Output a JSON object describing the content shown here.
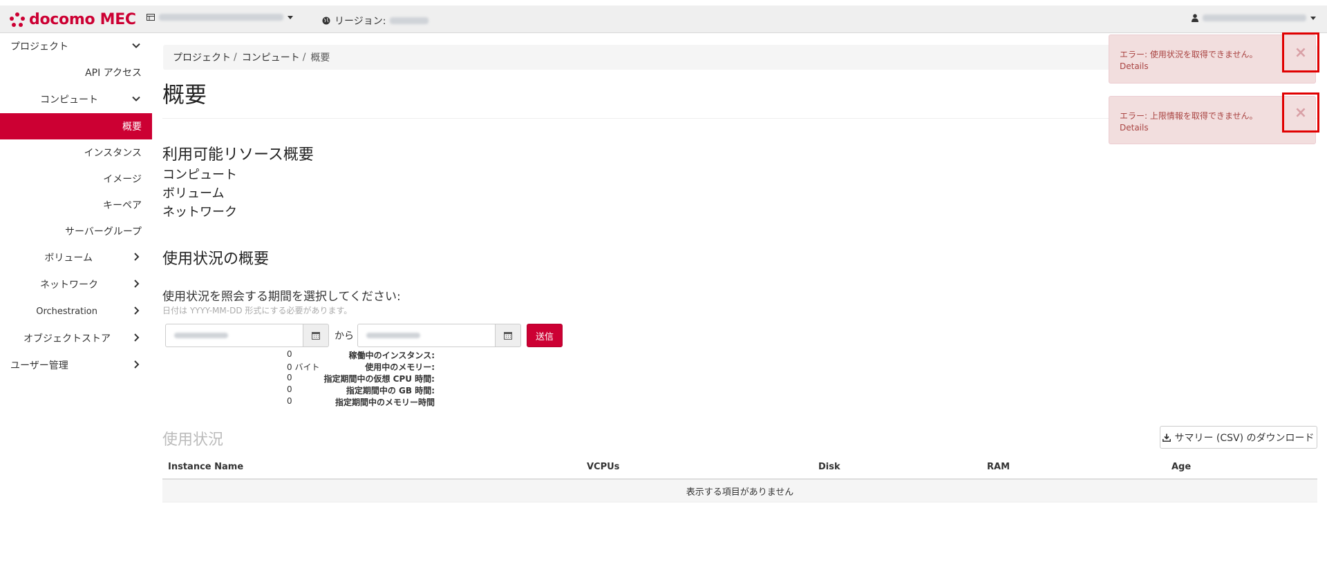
{
  "brand": {
    "name": "docomo MEC",
    "color": "#cc0033"
  },
  "topbar": {
    "region_label": "リージョン:",
    "project_icon": "project-icon",
    "region_icon": "globe-icon",
    "user_icon": "user-icon"
  },
  "sidebar": {
    "project": "プロジェクト",
    "api_access": "API アクセス",
    "compute": "コンピュート",
    "overview": "概要",
    "instances": "インスタンス",
    "images": "イメージ",
    "keypairs": "キーペア",
    "server_groups": "サーバーグループ",
    "volumes": "ボリューム",
    "network": "ネットワーク",
    "orchestration": "Orchestration",
    "object_store": "オブジェクトストア",
    "user_mgmt": "ユーザー管理"
  },
  "breadcrumb": {
    "item1": "プロジェクト",
    "item2": "コンピュート",
    "current": "概要",
    "sep": "/"
  },
  "page": {
    "title": "概要",
    "available_heading": "利用可能リソース概要",
    "res_compute": "コンピュート",
    "res_volume": "ボリューム",
    "res_network": "ネットワーク",
    "usage_summary_heading": "使用状況の概要",
    "period_label": "使用状況を照会する期間を選択してください:",
    "date_hint": "日付は YYYY-MM-DD 形式にする必要があります。",
    "from": "から",
    "submit": "送信"
  },
  "stats": [
    {
      "label": "稼働中のインスタンス:",
      "value": "0"
    },
    {
      "label": "使用中のメモリー:",
      "value": "0 バイト"
    },
    {
      "label": "指定期間中の仮想 CPU 時間:",
      "value": "0"
    },
    {
      "label": "指定期間中の GB 時間:",
      "value": "0"
    },
    {
      "label": "指定期間中のメモリー時間",
      "value": "0"
    }
  ],
  "usage": {
    "heading": "使用状況",
    "csv_button": "サマリー (CSV) のダウンロード",
    "columns": [
      "Instance Name",
      "VCPUs",
      "Disk",
      "RAM",
      "Age"
    ],
    "empty": "表示する項目がありません"
  },
  "alerts": [
    {
      "message": "エラー: 使用状況を取得できません。",
      "details": "Details",
      "close": "×"
    },
    {
      "message": "エラー: 上限情報を取得できません。",
      "details": "Details",
      "close": "×"
    }
  ]
}
